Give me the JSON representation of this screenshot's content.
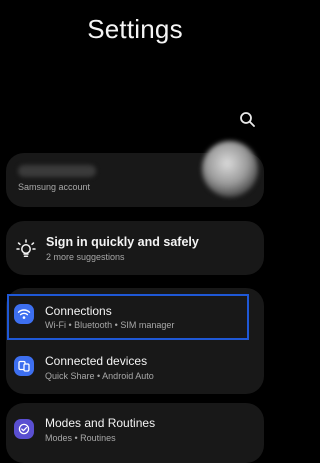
{
  "header": {
    "title": "Settings"
  },
  "search": {
    "icon": "search-icon"
  },
  "account": {
    "subtitle": "Samsung account",
    "avatar_icon": "avatar"
  },
  "suggestion": {
    "title": "Sign in quickly and safely",
    "subtitle": "2 more suggestions",
    "icon": "lightbulb-icon"
  },
  "items": [
    {
      "title": "Connections",
      "subtitle": "Wi-Fi • Bluetooth • SIM manager",
      "icon": "wifi-icon",
      "icon_color": "#3d6ff0",
      "selected": true
    },
    {
      "title": "Connected devices",
      "subtitle": "Quick Share • Android Auto",
      "icon": "connected-devices-icon",
      "icon_color": "#3d6ff0"
    },
    {
      "title": "Modes and Routines",
      "subtitle": "Modes • Routines",
      "icon": "routines-icon",
      "icon_color": "#5a4fd1"
    }
  ],
  "colors": {
    "background": "#000000",
    "card": "#181818",
    "highlight": "#1f58d6"
  }
}
